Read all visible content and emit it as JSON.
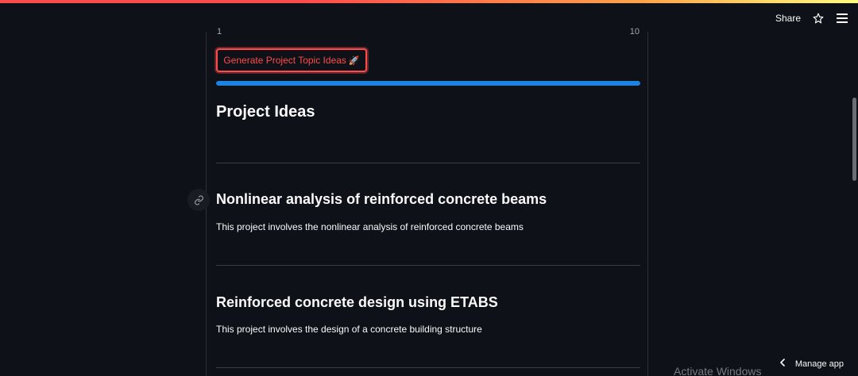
{
  "header": {
    "share_label": "Share",
    "star_icon": "star-icon",
    "menu_icon": "hamburger-menu-icon"
  },
  "slider": {
    "min_label": "1",
    "max_label": "10"
  },
  "generate_button": {
    "label": "Generate Project Topic Ideas",
    "icon": "rocket-icon",
    "glyph": "🚀"
  },
  "progress": {
    "percent": 100,
    "color": "#1c83e1"
  },
  "section": {
    "title": "Project Ideas"
  },
  "ideas": [
    {
      "title": "Nonlinear analysis of reinforced concrete beams",
      "description": "This project involves the nonlinear analysis of reinforced concrete beams"
    },
    {
      "title": "Reinforced concrete design using ETABS",
      "description": "This project involves the design of a concrete building structure"
    }
  ],
  "footer": {
    "manage_app_label": "Manage app",
    "watermark": "Activate Windows"
  },
  "colors": {
    "accent": "#ff4b4b",
    "background": "#0e1117",
    "text": "#fafafa"
  }
}
